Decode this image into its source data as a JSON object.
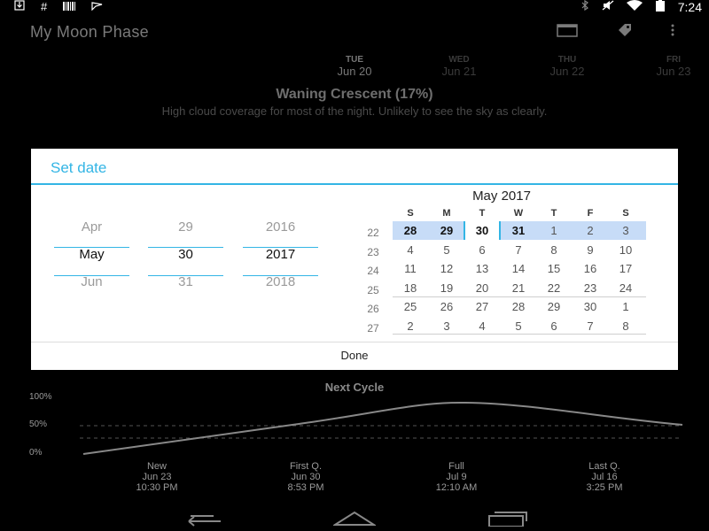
{
  "status_bar": {
    "left_icons": [
      "download-icon",
      "hash-icon",
      "barcode-icon",
      "flag-icon"
    ],
    "right_icons": [
      "bluetooth-icon",
      "mute-icon",
      "wifi-icon",
      "battery-icon"
    ],
    "time": "7:24"
  },
  "app": {
    "title": "My Moon Phase",
    "actions": [
      "calendar-icon",
      "tag-icon",
      "overflow-menu-icon"
    ]
  },
  "days": [
    {
      "dow": "TUE",
      "date": "Jun 20"
    },
    {
      "dow": "WED",
      "date": "Jun 21"
    },
    {
      "dow": "THU",
      "date": "Jun 22"
    },
    {
      "dow": "FRI",
      "date": "Jun 23"
    }
  ],
  "phase": {
    "title": "Waning Crescent (17%)",
    "subtitle": "High cloud coverage for most of the night. Unlikely to see the sky as clearly."
  },
  "dialog": {
    "title": "Set date",
    "month_spinner": {
      "prev": "Apr",
      "current": "May",
      "next": "Jun"
    },
    "day_spinner": {
      "prev": "29",
      "current": "30",
      "next": "31"
    },
    "year_spinner": {
      "prev": "2016",
      "current": "2017",
      "next": "2018"
    },
    "calendar": {
      "month_label": "May 2017",
      "weekday_headers": [
        "S",
        "M",
        "T",
        "W",
        "T",
        "F",
        "S"
      ],
      "week_numbers": [
        "22",
        "23",
        "24",
        "25",
        "26",
        "27"
      ],
      "weeks": [
        [
          "28",
          "29",
          "30",
          "31",
          "1",
          "2",
          "3"
        ],
        [
          "4",
          "5",
          "6",
          "7",
          "8",
          "9",
          "10"
        ],
        [
          "11",
          "12",
          "13",
          "14",
          "15",
          "16",
          "17"
        ],
        [
          "18",
          "19",
          "20",
          "21",
          "22",
          "23",
          "24"
        ],
        [
          "25",
          "26",
          "27",
          "28",
          "29",
          "30",
          "1"
        ],
        [
          "2",
          "3",
          "4",
          "5",
          "6",
          "7",
          "8"
        ]
      ]
    },
    "done_label": "Done"
  },
  "chart": {
    "title": "Next Cycle",
    "y_labels": [
      "100%",
      "50%",
      "0%"
    ],
    "x_labels": [
      {
        "name": "New",
        "date": "Jun 23",
        "time": "10:30 PM"
      },
      {
        "name": "First Q.",
        "date": "Jun 30",
        "time": "8:53 PM"
      },
      {
        "name": "Full",
        "date": "Jul 9",
        "time": "12:10 AM"
      },
      {
        "name": "Last Q.",
        "date": "Jul 16",
        "time": "3:25 PM"
      }
    ]
  },
  "colors": {
    "accent": "#33b5e5",
    "selected_week": "#c7dcf7"
  }
}
